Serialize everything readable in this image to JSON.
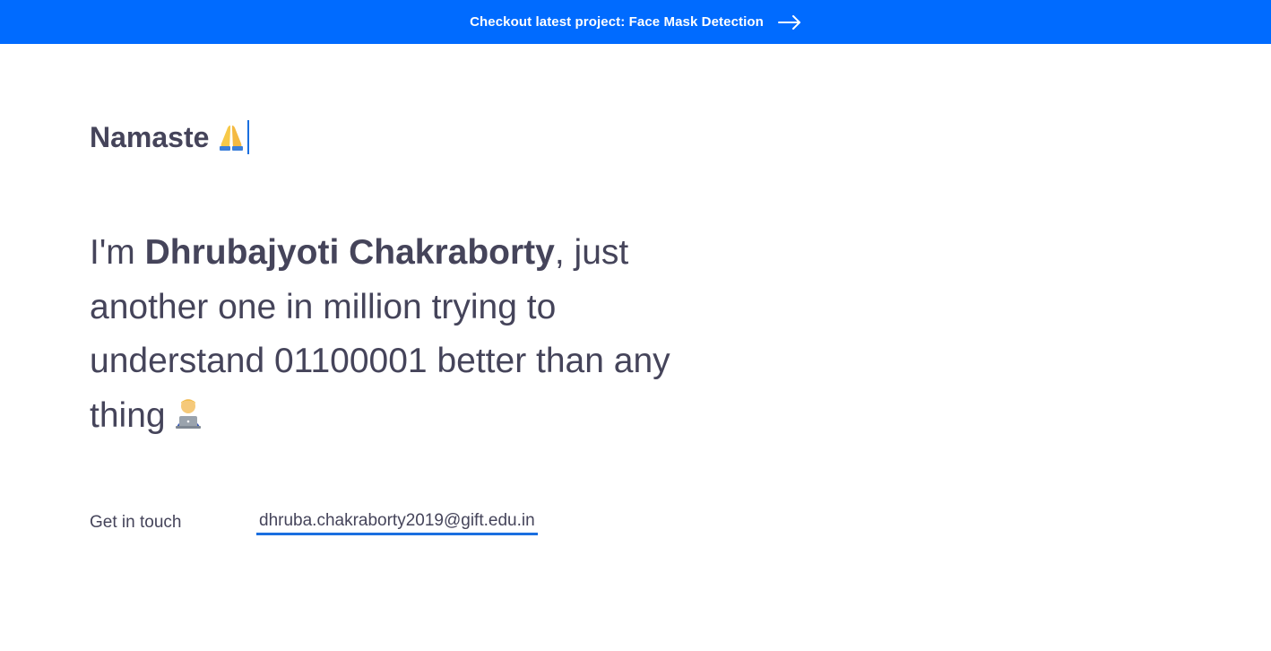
{
  "banner": {
    "text": "Checkout latest project: Face Mask Detection",
    "icon": "arrow-right-icon",
    "background": "#006bff"
  },
  "greeting": {
    "text": "Namaste",
    "emoji": "folded-hands-emoji"
  },
  "intro": {
    "prefix": "I'm ",
    "name": "Dhrubajyoti Chakraborty",
    "suffix": ", just another one in million trying to understand 01100001 better than any thing",
    "emoji": "technologist-emoji"
  },
  "contact": {
    "label": "Get in touch",
    "email": "dhruba.chakraborty2019@gift.edu.in",
    "accent": "#1a6fe0"
  },
  "colors": {
    "text": "#45445a",
    "background": "#ffffff"
  }
}
